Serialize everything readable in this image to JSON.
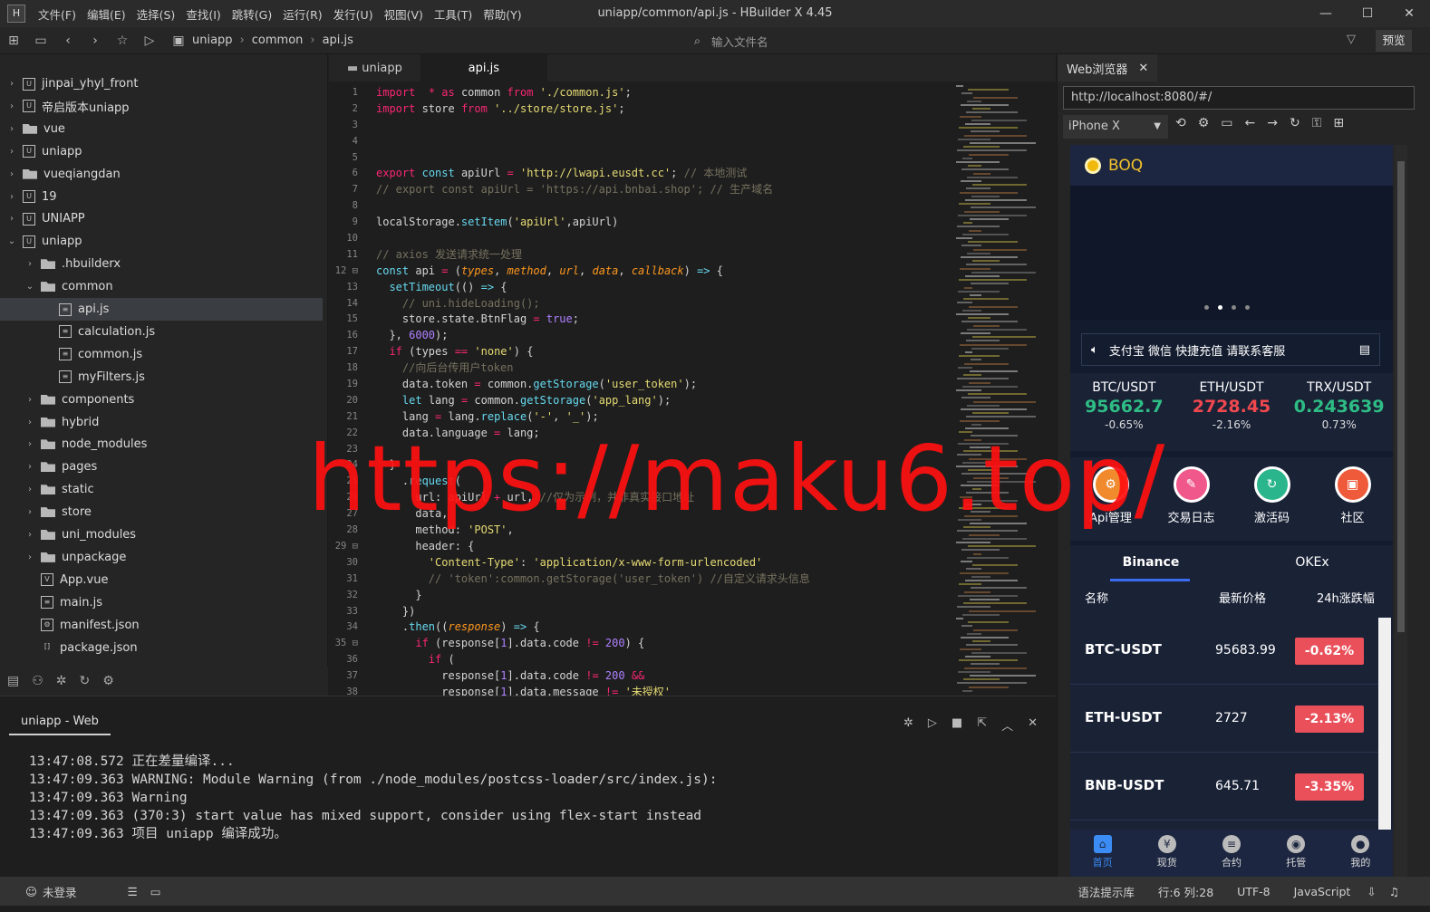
{
  "window": {
    "title": "uniapp/common/api.js - HBuilder X 4.45",
    "logo": "H",
    "menu": [
      "文件(F)",
      "编辑(E)",
      "选择(S)",
      "查找(I)",
      "跳转(G)",
      "运行(R)",
      "发行(U)",
      "视图(V)",
      "工具(T)",
      "帮助(Y)"
    ]
  },
  "toolbar": {
    "breadcrumb": [
      "uniapp",
      "common",
      "api.js"
    ],
    "search_placeholder": "输入文件名",
    "preview": "预览"
  },
  "sidebar": {
    "items": [
      {
        "label": "jinpai_yhyl_front",
        "indent": 0,
        "arrow": "›",
        "icon": "U"
      },
      {
        "label": "帝启版本uniapp",
        "indent": 0,
        "arrow": "›",
        "icon": "U"
      },
      {
        "label": "vue",
        "indent": 0,
        "arrow": "›",
        "icon": "folder"
      },
      {
        "label": "uniapp",
        "indent": 0,
        "arrow": "›",
        "icon": "U"
      },
      {
        "label": "vueqiangdan",
        "indent": 0,
        "arrow": "›",
        "icon": "folder"
      },
      {
        "label": "19",
        "indent": 0,
        "arrow": "›",
        "icon": "U"
      },
      {
        "label": "UNIAPP",
        "indent": 0,
        "arrow": "›",
        "icon": "U"
      },
      {
        "label": "uniapp",
        "indent": 0,
        "arrow": "⌄",
        "icon": "U"
      },
      {
        "label": ".hbuilderx",
        "indent": 1,
        "arrow": "›",
        "icon": "folder"
      },
      {
        "label": "common",
        "indent": 1,
        "arrow": "⌄",
        "icon": "folder"
      },
      {
        "label": "api.js",
        "indent": 2,
        "arrow": "",
        "icon": "file",
        "selected": true
      },
      {
        "label": "calculation.js",
        "indent": 2,
        "arrow": "",
        "icon": "file"
      },
      {
        "label": "common.js",
        "indent": 2,
        "arrow": "",
        "icon": "file"
      },
      {
        "label": "myFilters.js",
        "indent": 2,
        "arrow": "",
        "icon": "file"
      },
      {
        "label": "components",
        "indent": 1,
        "arrow": "›",
        "icon": "folder"
      },
      {
        "label": "hybrid",
        "indent": 1,
        "arrow": "›",
        "icon": "folder"
      },
      {
        "label": "node_modules",
        "indent": 1,
        "arrow": "›",
        "icon": "folder"
      },
      {
        "label": "pages",
        "indent": 1,
        "arrow": "›",
        "icon": "folder"
      },
      {
        "label": "static",
        "indent": 1,
        "arrow": "›",
        "icon": "folder"
      },
      {
        "label": "store",
        "indent": 1,
        "arrow": "›",
        "icon": "folder"
      },
      {
        "label": "uni_modules",
        "indent": 1,
        "arrow": "›",
        "icon": "folder"
      },
      {
        "label": "unpackage",
        "indent": 1,
        "arrow": "›",
        "icon": "folder"
      },
      {
        "label": "App.vue",
        "indent": 1,
        "arrow": "",
        "icon": "V"
      },
      {
        "label": "main.js",
        "indent": 1,
        "arrow": "",
        "icon": "file"
      },
      {
        "label": "manifest.json",
        "indent": 1,
        "arrow": "",
        "icon": "gear"
      },
      {
        "label": "package.json",
        "indent": 1,
        "arrow": "",
        "icon": "brackets"
      }
    ]
  },
  "editor": {
    "tabs": [
      "uniapp",
      "api.js"
    ],
    "active_tab": 1,
    "lines": [
      [
        [
          "kw",
          "import"
        ],
        [
          "",
          "  "
        ],
        [
          "kw",
          "*"
        ],
        [
          "",
          " "
        ],
        [
          "kw",
          "as"
        ],
        [
          "",
          " common "
        ],
        [
          "kw",
          "from"
        ],
        [
          "",
          " "
        ],
        [
          "st",
          "'./common.js'"
        ],
        [
          "",
          ";"
        ]
      ],
      [
        [
          "kw",
          "import"
        ],
        [
          "",
          " store "
        ],
        [
          "kw",
          "from"
        ],
        [
          "",
          " "
        ],
        [
          "st",
          "'../store/store.js'"
        ],
        [
          "",
          ";"
        ]
      ],
      [],
      [],
      [],
      [
        [
          "kw",
          "export"
        ],
        [
          "",
          " "
        ],
        [
          "fn",
          "const"
        ],
        [
          "",
          " apiUrl "
        ],
        [
          "kw",
          "="
        ],
        [
          "",
          " "
        ],
        [
          "st",
          "'http://lwapi.eusdt.cc'"
        ],
        [
          "",
          "; "
        ],
        [
          "cm",
          "// 本地测试"
        ]
      ],
      [
        [
          "cm",
          "// export const apiUrl = 'https://api.bnbai.shop'; // 生产域名"
        ]
      ],
      [],
      [
        [
          "",
          "localStorage."
        ],
        [
          "fn",
          "setItem"
        ],
        [
          "",
          "("
        ],
        [
          "st",
          "'apiUrl'"
        ],
        [
          "",
          ",apiUrl)"
        ]
      ],
      [],
      [
        [
          "cm",
          "// axios 发送请求统一处理"
        ]
      ],
      [
        [
          "fn",
          "const"
        ],
        [
          "",
          " api "
        ],
        [
          "kw",
          "="
        ],
        [
          "",
          " ("
        ],
        [
          "pa",
          "types"
        ],
        [
          "",
          ", "
        ],
        [
          "pa",
          "method"
        ],
        [
          "",
          ", "
        ],
        [
          "pa",
          "url"
        ],
        [
          "",
          ", "
        ],
        [
          "pa",
          "data"
        ],
        [
          "",
          ", "
        ],
        [
          "pa",
          "callback"
        ],
        [
          "",
          ") "
        ],
        [
          "fn",
          "=>"
        ],
        [
          "",
          " {"
        ]
      ],
      [
        [
          "",
          "  "
        ],
        [
          "fn",
          "setTimeout"
        ],
        [
          "",
          "(() "
        ],
        [
          "fn",
          "=>"
        ],
        [
          "",
          " {"
        ]
      ],
      [
        [
          "",
          "    "
        ],
        [
          "cm",
          "// uni.hideLoading();"
        ]
      ],
      [
        [
          "",
          "    store.state.BtnFlag "
        ],
        [
          "kw",
          "="
        ],
        [
          "",
          " "
        ],
        [
          "nu",
          "true"
        ],
        [
          "",
          ";"
        ]
      ],
      [
        [
          "",
          "  }, "
        ],
        [
          "nu",
          "6000"
        ],
        [
          "",
          ");"
        ]
      ],
      [
        [
          "",
          "  "
        ],
        [
          "kw",
          "if"
        ],
        [
          "",
          " (types "
        ],
        [
          "kw",
          "=="
        ],
        [
          "",
          " "
        ],
        [
          "st",
          "'none'"
        ],
        [
          "",
          ") {"
        ]
      ],
      [
        [
          "",
          "    "
        ],
        [
          "cm",
          "//向后台传用户token"
        ]
      ],
      [
        [
          "",
          "    data.token "
        ],
        [
          "kw",
          "="
        ],
        [
          "",
          " common."
        ],
        [
          "fn",
          "getStorage"
        ],
        [
          "",
          "("
        ],
        [
          "st",
          "'user_token'"
        ],
        [
          "",
          ");"
        ]
      ],
      [
        [
          "",
          "    "
        ],
        [
          "fn",
          "let"
        ],
        [
          "",
          " lang "
        ],
        [
          "kw",
          "="
        ],
        [
          "",
          " common."
        ],
        [
          "fn",
          "getStorage"
        ],
        [
          "",
          "("
        ],
        [
          "st",
          "'app_lang'"
        ],
        [
          "",
          ");"
        ]
      ],
      [
        [
          "",
          "    lang "
        ],
        [
          "kw",
          "="
        ],
        [
          "",
          " lang."
        ],
        [
          "fn",
          "replace"
        ],
        [
          "",
          "("
        ],
        [
          "st",
          "'-'"
        ],
        [
          "",
          ", "
        ],
        [
          "st",
          "'_'"
        ],
        [
          "",
          ");"
        ]
      ],
      [
        [
          "",
          "    data.language "
        ],
        [
          "kw",
          "="
        ],
        [
          "",
          " lang;"
        ]
      ],
      [],
      [
        [
          "",
          "  }"
        ]
      ],
      [
        [
          "",
          "    ."
        ],
        [
          "fn",
          "request"
        ],
        [
          "",
          "("
        ]
      ],
      [
        [
          "",
          "      url: apiUrl "
        ],
        [
          "kw",
          "+"
        ],
        [
          "",
          " url, "
        ],
        [
          "cm",
          "//仅为示例，并非真实接口地址"
        ]
      ],
      [
        [
          "",
          "      data,"
        ]
      ],
      [
        [
          "",
          "      method: "
        ],
        [
          "st",
          "'POST'"
        ],
        [
          "",
          ","
        ]
      ],
      [
        [
          "",
          "      header: {"
        ]
      ],
      [
        [
          "",
          "        "
        ],
        [
          "st",
          "'Content-Type'"
        ],
        [
          "",
          ": "
        ],
        [
          "st",
          "'application/x-www-form-urlencoded'"
        ]
      ],
      [
        [
          "",
          "        "
        ],
        [
          "cm",
          "// 'token':common.getStorage('user_token') //自定义请求头信息"
        ]
      ],
      [
        [
          "",
          "      }"
        ]
      ],
      [
        [
          "",
          "    })"
        ]
      ],
      [
        [
          "",
          "    ."
        ],
        [
          "fn",
          "then"
        ],
        [
          "",
          "(("
        ],
        [
          "pa",
          "response"
        ],
        [
          "",
          ") "
        ],
        [
          "fn",
          "=>"
        ],
        [
          "",
          " {"
        ]
      ],
      [
        [
          "",
          "      "
        ],
        [
          "kw",
          "if"
        ],
        [
          "",
          " (response["
        ],
        [
          "nu",
          "1"
        ],
        [
          "",
          "].data.code "
        ],
        [
          "kw",
          "!="
        ],
        [
          "",
          " "
        ],
        [
          "nu",
          "200"
        ],
        [
          "",
          ") {"
        ]
      ],
      [
        [
          "",
          "        "
        ],
        [
          "kw",
          "if"
        ],
        [
          "",
          " ("
        ]
      ],
      [
        [
          "",
          "          response["
        ],
        [
          "nu",
          "1"
        ],
        [
          "",
          "].data.code "
        ],
        [
          "kw",
          "!="
        ],
        [
          "",
          " "
        ],
        [
          "nu",
          "200"
        ],
        [
          "",
          " "
        ],
        [
          "kw",
          "&&"
        ]
      ],
      [
        [
          "",
          "          response["
        ],
        [
          "nu",
          "1"
        ],
        [
          "",
          "].data.message "
        ],
        [
          "kw",
          "!="
        ],
        [
          "",
          " "
        ],
        [
          "st",
          "'未授权'"
        ]
      ]
    ],
    "fold_lines": [
      12,
      29,
      35
    ],
    "folded_line_text": "· · ·"
  },
  "console": {
    "title": "uniapp - Web",
    "logs": [
      "13:47:08.572 正在差量编译...",
      "13:47:09.363 WARNING: Module Warning (from ./node_modules/postcss-loader/src/index.js):",
      "13:47:09.363 Warning",
      "13:47:09.363 (370:3) start value has mixed support, consider using flex-start instead",
      "13:47:09.363 项目 uniapp 编译成功。"
    ]
  },
  "statusbar": {
    "login": "未登录",
    "hint": "语法提示库",
    "position": "行:6  列:28",
    "encoding": "UTF-8",
    "language": "JavaScript"
  },
  "browser": {
    "tab": "Web浏览器",
    "url": "http://localhost:8080/#/",
    "device": "iPhone X",
    "app": {
      "brand": "BOQ",
      "notice": "支付宝 微信 快捷充值 请联系客服",
      "tickers": [
        {
          "pair": "BTC/USDT",
          "price": "95662.7",
          "change": "-0.65%",
          "color": "green"
        },
        {
          "pair": "ETH/USDT",
          "price": "2728.45",
          "change": "-2.16%",
          "color": "red"
        },
        {
          "pair": "TRX/USDT",
          "price": "0.243639",
          "change": "0.73%",
          "color": "green"
        }
      ],
      "quick": [
        {
          "label": "Api管理",
          "color": "#f08a2c"
        },
        {
          "label": "交易日志",
          "color": "#f0578a"
        },
        {
          "label": "激活码",
          "color": "#2bb58c"
        },
        {
          "label": "社区",
          "color": "#ef5b3a"
        }
      ],
      "market_tabs": [
        "Binance",
        "OKEx"
      ],
      "market_headers": [
        "名称",
        "最新价格",
        "24h涨跌幅"
      ],
      "rows": [
        {
          "symbol": "BTC-USDT",
          "price": "95683.99",
          "change": "-0.62%"
        },
        {
          "symbol": "ETH-USDT",
          "price": "2727",
          "change": "-2.13%"
        },
        {
          "symbol": "BNB-USDT",
          "price": "645.71",
          "change": "-3.35%"
        }
      ],
      "nav": [
        {
          "label": "首页",
          "icon": "⌂"
        },
        {
          "label": "现货",
          "icon": "¥"
        },
        {
          "label": "合约",
          "icon": "≡"
        },
        {
          "label": "托管",
          "icon": "◉"
        },
        {
          "label": "我的",
          "icon": "●"
        }
      ]
    }
  },
  "watermark": "https://maku6.top/",
  "colors": {
    "accent": "#3b8cf5",
    "brand": "#f3c22e",
    "up": "#2ebd85",
    "down": "#f0484f",
    "badge": "#e9505a"
  }
}
